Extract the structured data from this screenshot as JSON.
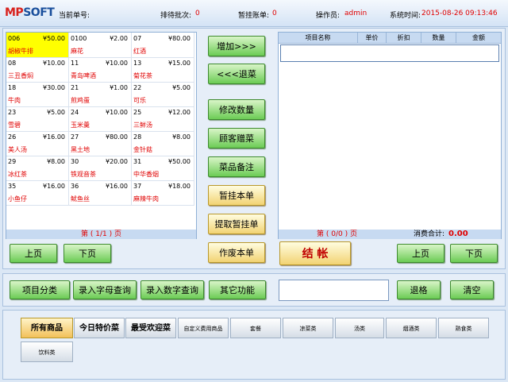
{
  "header": {
    "logo_a": "MP",
    "logo_b": "SOFT",
    "order_label": "当前单号:",
    "batch_label": "排待批次:",
    "batch_value": "0",
    "pending_label": "暂挂账单:",
    "pending_value": "0",
    "operator_label": "操作员:",
    "operator_value": "admin",
    "time_label": "系统时间:",
    "time_value": "2015-08-26 09:13:46"
  },
  "menu_items": [
    {
      "code": "006",
      "price": "¥50.00",
      "name": "胡椒牛排",
      "selected": true
    },
    {
      "code": "0100",
      "price": "¥2.00",
      "name": "麻花"
    },
    {
      "code": "07",
      "price": "¥80.00",
      "name": "红酒"
    },
    {
      "code": "08",
      "price": "¥10.00",
      "name": "三丑香焖"
    },
    {
      "code": "11",
      "price": "¥10.00",
      "name": "青岛啤酒"
    },
    {
      "code": "13",
      "price": "¥15.00",
      "name": "菊花茶"
    },
    {
      "code": "18",
      "price": "¥30.00",
      "name": "牛肉"
    },
    {
      "code": "21",
      "price": "¥1.00",
      "name": "煎鸡蛋"
    },
    {
      "code": "22",
      "price": "¥5.00",
      "name": "可乐"
    },
    {
      "code": "23",
      "price": "¥5.00",
      "name": "雪碧"
    },
    {
      "code": "24",
      "price": "¥10.00",
      "name": "玉米羹"
    },
    {
      "code": "25",
      "price": "¥12.00",
      "name": "三鲜汤"
    },
    {
      "code": "26",
      "price": "¥16.00",
      "name": "美人汤"
    },
    {
      "code": "27",
      "price": "¥80.00",
      "name": "黑土地"
    },
    {
      "code": "28",
      "price": "¥8.00",
      "name": "金针菇"
    },
    {
      "code": "29",
      "price": "¥8.00",
      "name": "冰红茶"
    },
    {
      "code": "30",
      "price": "¥20.00",
      "name": "铁观音茶"
    },
    {
      "code": "31",
      "price": "¥50.00",
      "name": "中华香烟"
    },
    {
      "code": "35",
      "price": "¥16.00",
      "name": "小鱼仔"
    },
    {
      "code": "36",
      "price": "¥16.00",
      "name": "鱿鱼丝"
    },
    {
      "code": "37",
      "price": "¥18.00",
      "name": "麻辣牛肉"
    }
  ],
  "left_pager": {
    "text": "第  ( 1/1 )  页",
    "prev": "上页",
    "next": "下页"
  },
  "actions": {
    "add": "增加>>>",
    "back": "<<<退菜",
    "modify": "修改数量",
    "gift": "顾客赠菜",
    "note": "菜品备注",
    "hold": "暂挂本单",
    "fetch": "提取暂挂单",
    "void": "作废本单",
    "checkout": "结 帐"
  },
  "order_table": {
    "columns": [
      "项目名称",
      "单价",
      "折扣",
      "数量",
      "金额"
    ],
    "pager_text": "第  ( 0/0 )  页",
    "total_label": "消费合计:",
    "total_value": "0.00",
    "prev": "上页",
    "next": "下页"
  },
  "func_bar": {
    "category": "项目分类",
    "letter_query": "录入字母查询",
    "number_query": "录入数字查询",
    "other": "其它功能",
    "input_value": "",
    "backspace": "退格",
    "clear": "清空"
  },
  "category_tabs": {
    "all": "所有商品",
    "today": "今日特价菜",
    "popular": "最受欢迎菜",
    "items": [
      "自定义费用商品",
      "套餐",
      "凉菜类",
      "汤类",
      "烟酒类",
      "熟食类",
      "饮料类"
    ]
  }
}
